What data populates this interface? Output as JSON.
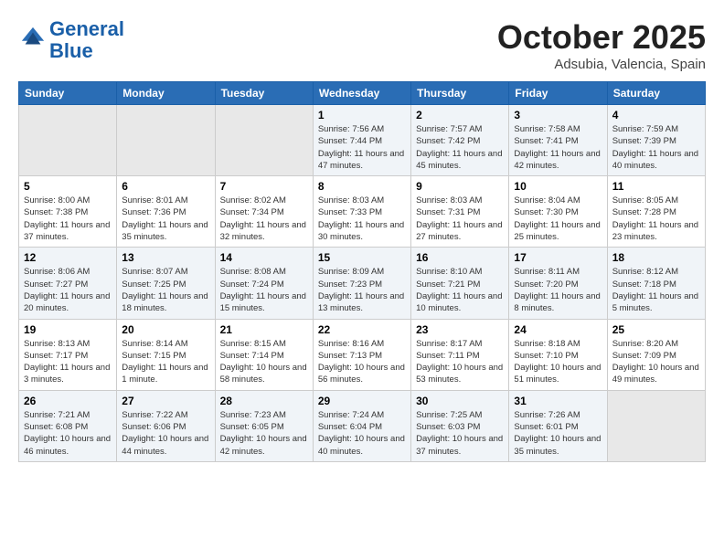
{
  "header": {
    "logo_line1": "General",
    "logo_line2": "Blue",
    "month": "October 2025",
    "location": "Adsubia, Valencia, Spain"
  },
  "days_of_week": [
    "Sunday",
    "Monday",
    "Tuesday",
    "Wednesday",
    "Thursday",
    "Friday",
    "Saturday"
  ],
  "weeks": [
    [
      {
        "day": "",
        "info": ""
      },
      {
        "day": "",
        "info": ""
      },
      {
        "day": "",
        "info": ""
      },
      {
        "day": "1",
        "info": "Sunrise: 7:56 AM\nSunset: 7:44 PM\nDaylight: 11 hours and 47 minutes."
      },
      {
        "day": "2",
        "info": "Sunrise: 7:57 AM\nSunset: 7:42 PM\nDaylight: 11 hours and 45 minutes."
      },
      {
        "day": "3",
        "info": "Sunrise: 7:58 AM\nSunset: 7:41 PM\nDaylight: 11 hours and 42 minutes."
      },
      {
        "day": "4",
        "info": "Sunrise: 7:59 AM\nSunset: 7:39 PM\nDaylight: 11 hours and 40 minutes."
      }
    ],
    [
      {
        "day": "5",
        "info": "Sunrise: 8:00 AM\nSunset: 7:38 PM\nDaylight: 11 hours and 37 minutes."
      },
      {
        "day": "6",
        "info": "Sunrise: 8:01 AM\nSunset: 7:36 PM\nDaylight: 11 hours and 35 minutes."
      },
      {
        "day": "7",
        "info": "Sunrise: 8:02 AM\nSunset: 7:34 PM\nDaylight: 11 hours and 32 minutes."
      },
      {
        "day": "8",
        "info": "Sunrise: 8:03 AM\nSunset: 7:33 PM\nDaylight: 11 hours and 30 minutes."
      },
      {
        "day": "9",
        "info": "Sunrise: 8:03 AM\nSunset: 7:31 PM\nDaylight: 11 hours and 27 minutes."
      },
      {
        "day": "10",
        "info": "Sunrise: 8:04 AM\nSunset: 7:30 PM\nDaylight: 11 hours and 25 minutes."
      },
      {
        "day": "11",
        "info": "Sunrise: 8:05 AM\nSunset: 7:28 PM\nDaylight: 11 hours and 23 minutes."
      }
    ],
    [
      {
        "day": "12",
        "info": "Sunrise: 8:06 AM\nSunset: 7:27 PM\nDaylight: 11 hours and 20 minutes."
      },
      {
        "day": "13",
        "info": "Sunrise: 8:07 AM\nSunset: 7:25 PM\nDaylight: 11 hours and 18 minutes."
      },
      {
        "day": "14",
        "info": "Sunrise: 8:08 AM\nSunset: 7:24 PM\nDaylight: 11 hours and 15 minutes."
      },
      {
        "day": "15",
        "info": "Sunrise: 8:09 AM\nSunset: 7:23 PM\nDaylight: 11 hours and 13 minutes."
      },
      {
        "day": "16",
        "info": "Sunrise: 8:10 AM\nSunset: 7:21 PM\nDaylight: 11 hours and 10 minutes."
      },
      {
        "day": "17",
        "info": "Sunrise: 8:11 AM\nSunset: 7:20 PM\nDaylight: 11 hours and 8 minutes."
      },
      {
        "day": "18",
        "info": "Sunrise: 8:12 AM\nSunset: 7:18 PM\nDaylight: 11 hours and 5 minutes."
      }
    ],
    [
      {
        "day": "19",
        "info": "Sunrise: 8:13 AM\nSunset: 7:17 PM\nDaylight: 11 hours and 3 minutes."
      },
      {
        "day": "20",
        "info": "Sunrise: 8:14 AM\nSunset: 7:15 PM\nDaylight: 11 hours and 1 minute."
      },
      {
        "day": "21",
        "info": "Sunrise: 8:15 AM\nSunset: 7:14 PM\nDaylight: 10 hours and 58 minutes."
      },
      {
        "day": "22",
        "info": "Sunrise: 8:16 AM\nSunset: 7:13 PM\nDaylight: 10 hours and 56 minutes."
      },
      {
        "day": "23",
        "info": "Sunrise: 8:17 AM\nSunset: 7:11 PM\nDaylight: 10 hours and 53 minutes."
      },
      {
        "day": "24",
        "info": "Sunrise: 8:18 AM\nSunset: 7:10 PM\nDaylight: 10 hours and 51 minutes."
      },
      {
        "day": "25",
        "info": "Sunrise: 8:20 AM\nSunset: 7:09 PM\nDaylight: 10 hours and 49 minutes."
      }
    ],
    [
      {
        "day": "26",
        "info": "Sunrise: 7:21 AM\nSunset: 6:08 PM\nDaylight: 10 hours and 46 minutes."
      },
      {
        "day": "27",
        "info": "Sunrise: 7:22 AM\nSunset: 6:06 PM\nDaylight: 10 hours and 44 minutes."
      },
      {
        "day": "28",
        "info": "Sunrise: 7:23 AM\nSunset: 6:05 PM\nDaylight: 10 hours and 42 minutes."
      },
      {
        "day": "29",
        "info": "Sunrise: 7:24 AM\nSunset: 6:04 PM\nDaylight: 10 hours and 40 minutes."
      },
      {
        "day": "30",
        "info": "Sunrise: 7:25 AM\nSunset: 6:03 PM\nDaylight: 10 hours and 37 minutes."
      },
      {
        "day": "31",
        "info": "Sunrise: 7:26 AM\nSunset: 6:01 PM\nDaylight: 10 hours and 35 minutes."
      },
      {
        "day": "",
        "info": ""
      }
    ]
  ]
}
